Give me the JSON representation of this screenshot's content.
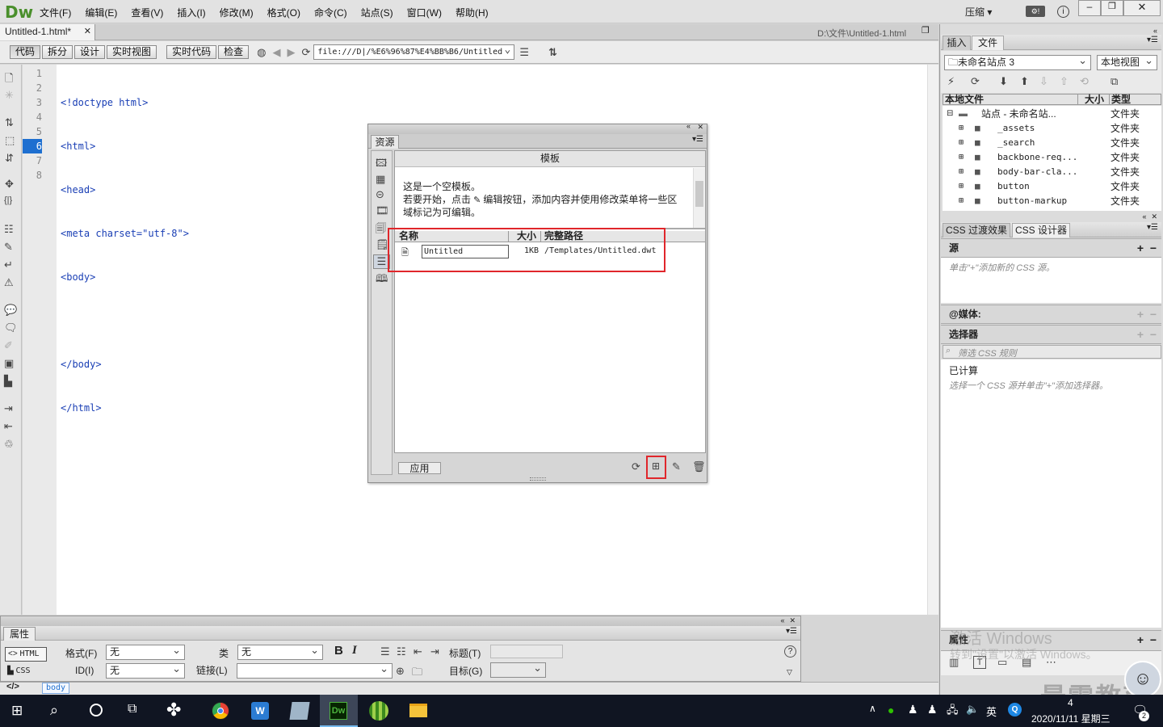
{
  "app": {
    "logo": "Dw",
    "menu": [
      "文件(F)",
      "编辑(E)",
      "查看(V)",
      "插入(I)",
      "修改(M)",
      "格式(O)",
      "命令(C)",
      "站点(S)",
      "窗口(W)",
      "帮助(H)"
    ],
    "workspace": "压缩"
  },
  "doc_tab": {
    "name": "Untitled-1.html*",
    "path": "D:\\文件\\Untitled-1.html"
  },
  "doc_toolbar": {
    "views": [
      "代码",
      "拆分",
      "设计",
      "实时视图"
    ],
    "live_code": "实时代码",
    "inspect": "检查",
    "address": "file:///D|/%E6%96%87%E4%BB%B6/Untitled"
  },
  "code": {
    "line_numbers": [
      "1",
      "2",
      "3",
      "4",
      "5",
      "6",
      "7",
      "8"
    ],
    "lines": [
      "<!doctype html>",
      "<html>",
      "<head>",
      "<meta charset=\"utf-8\">",
      "<body>",
      "",
      "</body>",
      "</html>"
    ],
    "current_line": "6"
  },
  "assets": {
    "tab": "资源",
    "header": "模板",
    "preview_lines": [
      "这是一个空模板。",
      "若要开始，点击",
      "编辑按钮，添加内容并使用修改菜单将一些区",
      "域标记为可编辑。"
    ],
    "columns": {
      "name": "名称",
      "size": "大小",
      "path": "完整路径"
    },
    "rows": [
      {
        "name": "Untitled",
        "size": "1KB",
        "path": "/Templates/Untitled.dwt"
      }
    ],
    "apply": "应用"
  },
  "files_panel": {
    "tabs": [
      "插入",
      "文件"
    ],
    "site": "未命名站点 3",
    "view": "本地视图",
    "columns": {
      "local": "本地文件",
      "size": "大小",
      "type": "类型"
    },
    "root": {
      "name": "站点 - 未命名站...",
      "type": "文件夹"
    },
    "items": [
      {
        "name": "_assets",
        "type": "文件夹"
      },
      {
        "name": "_search",
        "type": "文件夹"
      },
      {
        "name": "backbone-req...",
        "type": "文件夹"
      },
      {
        "name": "body-bar-cla...",
        "type": "文件夹"
      },
      {
        "name": "button",
        "type": "文件夹"
      },
      {
        "name": "button-markup",
        "type": "文件夹"
      }
    ]
  },
  "css_panel": {
    "tabs": [
      "CSS 过渡效果",
      "CSS 设计器"
    ],
    "source_label": "源",
    "source_hint": "单击\"+\"添加新的 CSS 源。",
    "media_label": "@媒体:",
    "selector_label": "选择器",
    "filter_placeholder": "筛选 CSS 规则",
    "computed_label": "已计算",
    "computed_hint": "选择一个 CSS 源并单击\"+\"添加选择器。",
    "properties_label": "属性"
  },
  "properties": {
    "title": "属性",
    "html_btn": "HTML",
    "css_btn": "CSS",
    "format_label": "格式(F)",
    "format_value": "无",
    "id_label": "ID(I)",
    "id_value": "无",
    "class_label": "类",
    "class_value": "无",
    "link_label": "链接(L)",
    "title_label": "标题(T)",
    "target_label": "目标(G)"
  },
  "status": {
    "tag": "body"
  },
  "watermark": {
    "line1": "激活 Windows",
    "line2": "转到\"设置\"以激活 Windows。",
    "brand": "最需教育"
  },
  "taskbar": {
    "ime": "英",
    "date": "2020/11/11 星期三",
    "time": "4",
    "badge": "2"
  },
  "colors": {
    "accent": "#1e6fd0",
    "highlight": "#e0262b",
    "code_blue": "#1a3fb5",
    "dw_green": "#4a8f2c"
  }
}
